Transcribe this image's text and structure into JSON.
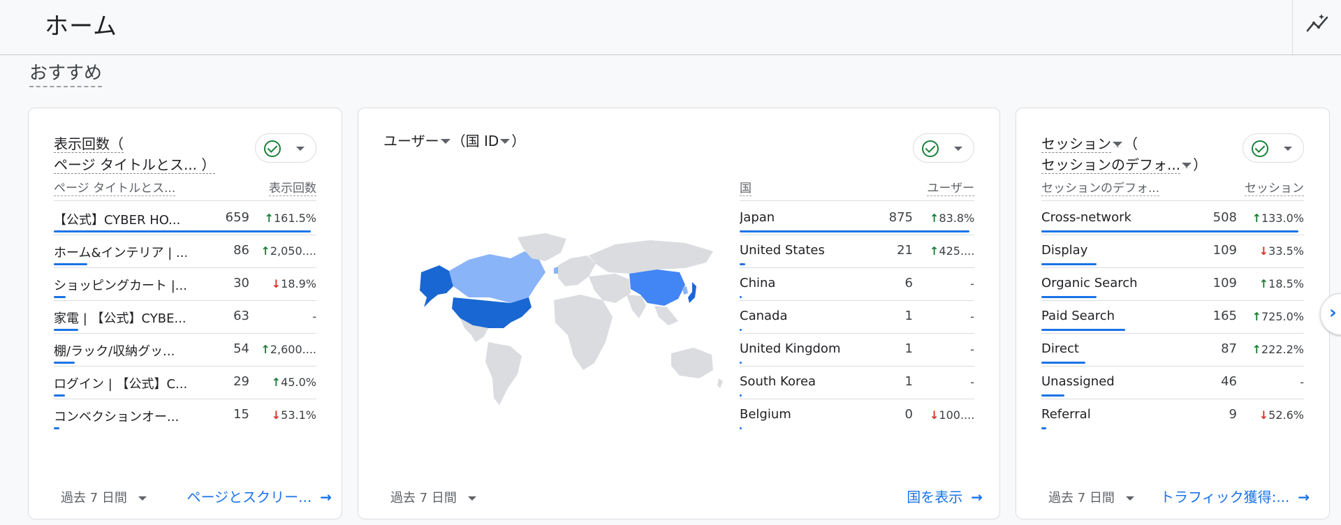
{
  "header": {
    "title": "ホーム"
  },
  "section_title": "おすすめ",
  "colors": {
    "accent": "#1a73e8",
    "up": "#188038",
    "down": "#d93025",
    "map_dark": "#1967d2",
    "map_mid": "#4285f4",
    "map_light": "#8ab4f8",
    "map_none": "#dadce0"
  },
  "card1": {
    "title_line1": "表示回数（",
    "title_line2": "ページ タイトルとス... ）",
    "col_name": "ページ タイトルとス...",
    "col_value": "表示回数",
    "rows": [
      {
        "name": "【公式】CYBER HO...",
        "value": "659",
        "dir": "up",
        "change": "161.5%",
        "pct": 1.0
      },
      {
        "name": "ホーム&インテリア | ...",
        "value": "86",
        "dir": "up",
        "change": "2,050....",
        "pct": 0.13
      },
      {
        "name": "ショッピングカート |...",
        "value": "30",
        "dir": "down",
        "change": "18.9%",
        "pct": 0.046
      },
      {
        "name": "家電 | 【公式】CYBE...",
        "value": "63",
        "dir": "none",
        "change": "-",
        "pct": 0.096
      },
      {
        "name": "棚/ラック/収納グッ...",
        "value": "54",
        "dir": "up",
        "change": "2,600....",
        "pct": 0.082
      },
      {
        "name": "ログイン | 【公式】C...",
        "value": "29",
        "dir": "up",
        "change": "45.0%",
        "pct": 0.044
      },
      {
        "name": "コンベクションオー...",
        "value": "15",
        "dir": "down",
        "change": "53.1%",
        "pct": 0.023
      }
    ],
    "period": "過去 7 日間",
    "link": "ページとスクリー..."
  },
  "card2": {
    "title_a": "ユーザー",
    "title_b": "（国 ID",
    "title_c": "）",
    "col_name": "国",
    "col_value": "ユーザー",
    "rows": [
      {
        "name": "Japan",
        "value": "875",
        "dir": "up",
        "change": "83.8%",
        "pct": 1.0
      },
      {
        "name": "United States",
        "value": "21",
        "dir": "up",
        "change": "425....",
        "pct": 0.024
      },
      {
        "name": "China",
        "value": "6",
        "dir": "none",
        "change": "-",
        "pct": 0.007
      },
      {
        "name": "Canada",
        "value": "1",
        "dir": "none",
        "change": "-",
        "pct": 0.0012
      },
      {
        "name": "United Kingdom",
        "value": "1",
        "dir": "none",
        "change": "-",
        "pct": 0.0012
      },
      {
        "name": "South Korea",
        "value": "1",
        "dir": "none",
        "change": "-",
        "pct": 0.0012
      },
      {
        "name": "Belgium",
        "value": "0",
        "dir": "down",
        "change": "100....",
        "pct": 0
      }
    ],
    "period": "過去 7 日間",
    "link": "国を表示"
  },
  "card3": {
    "title_line1_a": "セッション",
    "title_line1_b": "（",
    "title_line2": "セッションのデフォ...",
    "title_line2_end": "）",
    "col_name": "セッションのデフォ...",
    "col_value": "セッション",
    "rows": [
      {
        "name": "Cross-network",
        "value": "508",
        "dir": "up",
        "change": "133.0%",
        "pct": 1.0
      },
      {
        "name": "Display",
        "value": "109",
        "dir": "down",
        "change": "33.5%",
        "pct": 0.215
      },
      {
        "name": "Organic Search",
        "value": "109",
        "dir": "up",
        "change": "18.5%",
        "pct": 0.215
      },
      {
        "name": "Paid Search",
        "value": "165",
        "dir": "up",
        "change": "725.0%",
        "pct": 0.325
      },
      {
        "name": "Direct",
        "value": "87",
        "dir": "up",
        "change": "222.2%",
        "pct": 0.171
      },
      {
        "name": "Unassigned",
        "value": "46",
        "dir": "none",
        "change": "-",
        "pct": 0.09
      },
      {
        "name": "Referral",
        "value": "9",
        "dir": "down",
        "change": "52.6%",
        "pct": 0.018
      }
    ],
    "period": "過去 7 日間",
    "link": "トラフィック獲得:..."
  }
}
